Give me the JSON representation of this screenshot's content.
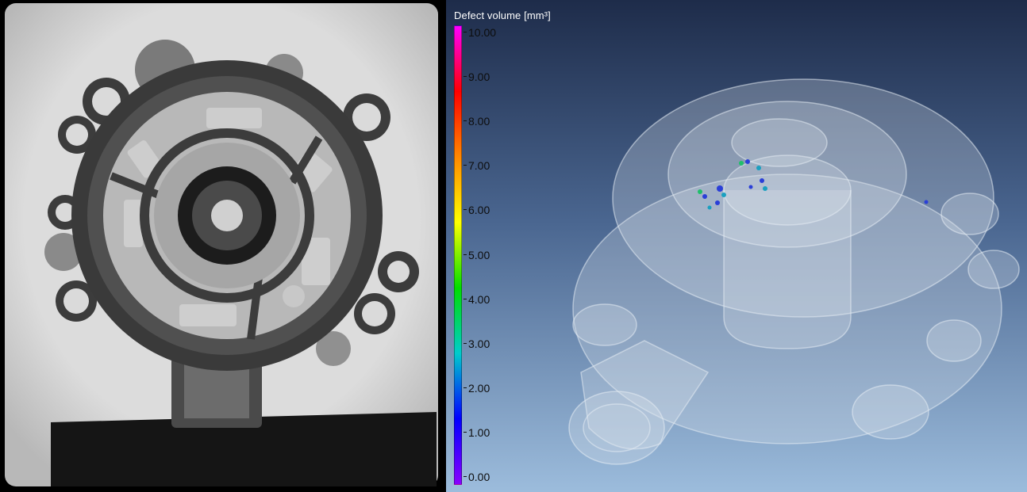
{
  "legend": {
    "title": "Defect volume [mm³]",
    "ticks": [
      "10.00",
      "9.00",
      "8.00",
      "7.00",
      "6.00",
      "5.00",
      "4.00",
      "3.00",
      "2.00",
      "1.00",
      "0.00"
    ],
    "colormap": [
      "#ff00ff",
      "#ff0000",
      "#ff8800",
      "#ffff00",
      "#00dd00",
      "#00cccc",
      "#0000ff",
      "#8800ff"
    ]
  },
  "panels": {
    "left": "xray-radiograph",
    "right": "3d-defect-render"
  },
  "colors": {
    "render_bg_top": "#1e2c4a",
    "render_bg_bottom": "#9cbcdc",
    "xray_bg": "#d9d9d9",
    "defect_blue": "#2a3fd8",
    "defect_green": "#1fbf6a",
    "defect_cyan": "#1aa0c0"
  }
}
